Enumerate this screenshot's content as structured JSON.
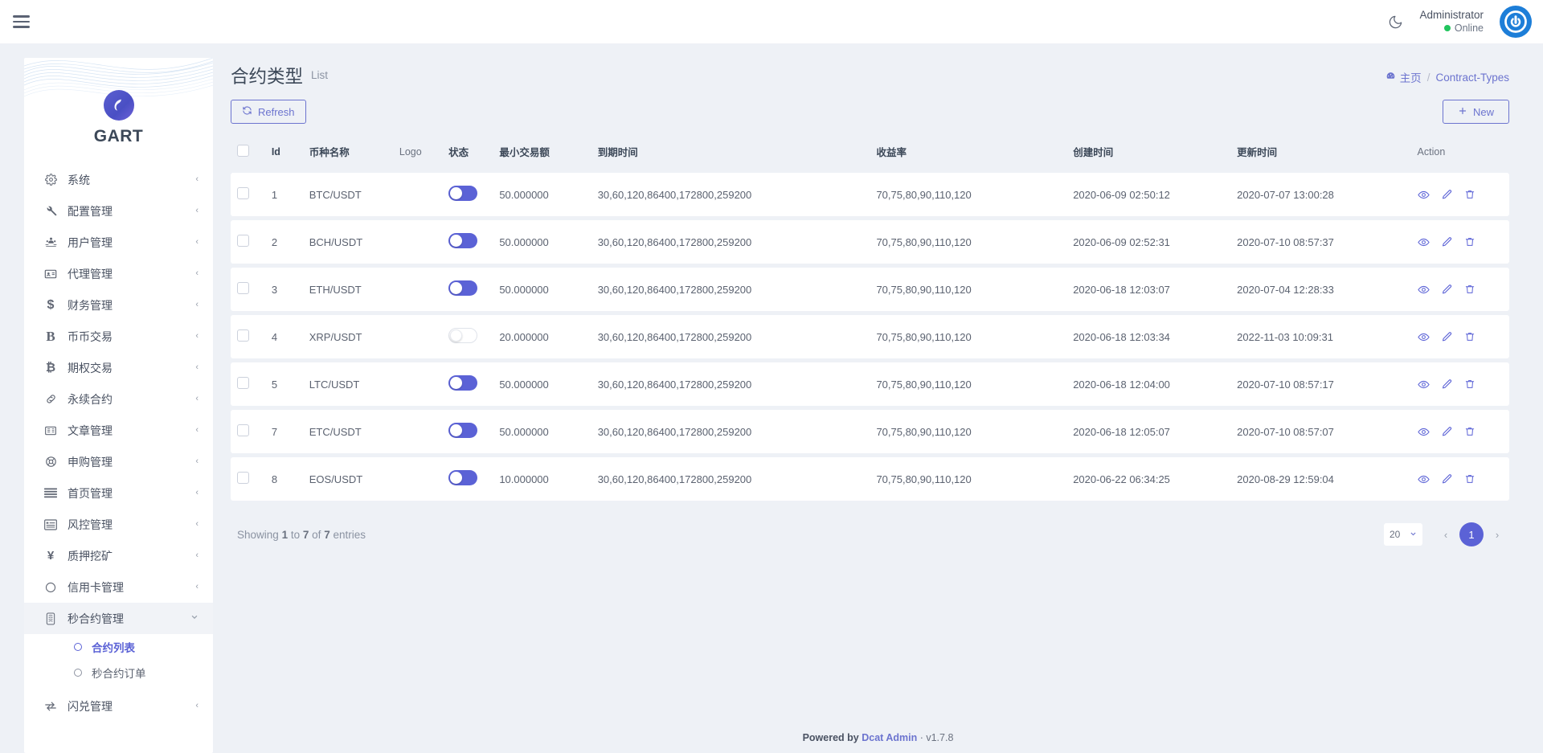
{
  "topbar": {
    "menu_icon": "hamburger-icon",
    "theme_icon": "moon-icon",
    "user_name": "Administrator",
    "user_status": "Online",
    "avatar_icon": "user-avatar-icon"
  },
  "sidebar": {
    "brand": "GART",
    "items": [
      {
        "label": "系统",
        "icon": "gear-icon",
        "caret": "‹"
      },
      {
        "label": "配置管理",
        "icon": "wrench-icon",
        "caret": "‹"
      },
      {
        "label": "用户管理",
        "icon": "users-icon",
        "caret": "‹"
      },
      {
        "label": "代理管理",
        "icon": "id-card-icon",
        "caret": "‹"
      },
      {
        "label": "财务管理",
        "icon": "dollar-icon",
        "caret": "‹"
      },
      {
        "label": "币币交易",
        "icon": "bold-b-icon",
        "caret": "‹"
      },
      {
        "label": "期权交易",
        "icon": "bitcoin-icon",
        "caret": "‹"
      },
      {
        "label": "永续合约",
        "icon": "link-icon",
        "caret": "‹"
      },
      {
        "label": "文章管理",
        "icon": "book-icon",
        "caret": "‹"
      },
      {
        "label": "申购管理",
        "icon": "lifebuoy-icon",
        "caret": "‹"
      },
      {
        "label": "首页管理",
        "icon": "bars-icon",
        "caret": "‹"
      },
      {
        "label": "风控管理",
        "icon": "list-alt-icon",
        "caret": "‹"
      },
      {
        "label": "质押挖矿",
        "icon": "yen-icon",
        "caret": "‹"
      },
      {
        "label": "信用卡管理",
        "icon": "circle-icon",
        "caret": "‹"
      }
    ],
    "expanded_group": {
      "label": "秒合约管理",
      "icon": "stamp-icon",
      "caret": "⌄"
    },
    "subitems": [
      {
        "label": "合约列表",
        "selected": true
      },
      {
        "label": "秒合约订单",
        "selected": false
      }
    ],
    "last_item": {
      "label": "闪兑管理",
      "icon": "exchange-icon",
      "caret": "‹"
    }
  },
  "page": {
    "title": "合约类型",
    "subtitle": "List",
    "breadcrumb_home": "主页",
    "breadcrumb_sep": "/",
    "breadcrumb_current": "Contract-Types",
    "refresh_label": "Refresh",
    "refresh_icon": "refresh-icon",
    "new_label": "New",
    "new_icon": "plus-icon"
  },
  "table": {
    "columns": [
      "",
      "Id",
      "币种名称",
      "Logo",
      "状态",
      "最小交易额",
      "到期时间",
      "收益率",
      "创建时间",
      "更新时间",
      "Action"
    ],
    "rows": [
      {
        "id": "1",
        "name": "BTC/USDT",
        "logo": "",
        "status": true,
        "min": "50.000000",
        "expiry": "30,60,120,86400,172800,259200",
        "rate": "70,75,80,90,110,120",
        "created": "2020-06-09 02:50:12",
        "updated": "2020-07-07 13:00:28"
      },
      {
        "id": "2",
        "name": "BCH/USDT",
        "logo": "",
        "status": true,
        "min": "50.000000",
        "expiry": "30,60,120,86400,172800,259200",
        "rate": "70,75,80,90,110,120",
        "created": "2020-06-09 02:52:31",
        "updated": "2020-07-10 08:57:37"
      },
      {
        "id": "3",
        "name": "ETH/USDT",
        "logo": "",
        "status": true,
        "min": "50.000000",
        "expiry": "30,60,120,86400,172800,259200",
        "rate": "70,75,80,90,110,120",
        "created": "2020-06-18 12:03:07",
        "updated": "2020-07-04 12:28:33"
      },
      {
        "id": "4",
        "name": "XRP/USDT",
        "logo": "",
        "status": false,
        "min": "20.000000",
        "expiry": "30,60,120,86400,172800,259200",
        "rate": "70,75,80,90,110,120",
        "created": "2020-06-18 12:03:34",
        "updated": "2022-11-03 10:09:31"
      },
      {
        "id": "5",
        "name": "LTC/USDT",
        "logo": "",
        "status": true,
        "min": "50.000000",
        "expiry": "30,60,120,86400,172800,259200",
        "rate": "70,75,80,90,110,120",
        "created": "2020-06-18 12:04:00",
        "updated": "2020-07-10 08:57:17"
      },
      {
        "id": "7",
        "name": "ETC/USDT",
        "logo": "",
        "status": true,
        "min": "50.000000",
        "expiry": "30,60,120,86400,172800,259200",
        "rate": "70,75,80,90,110,120",
        "created": "2020-06-18 12:05:07",
        "updated": "2020-07-10 08:57:07"
      },
      {
        "id": "8",
        "name": "EOS/USDT",
        "logo": "",
        "status": true,
        "min": "10.000000",
        "expiry": "30,60,120,86400,172800,259200",
        "rate": "70,75,80,90,110,120",
        "created": "2020-06-22 06:34:25",
        "updated": "2020-08-29 12:59:04"
      }
    ],
    "row_action_icons": [
      "eye-icon",
      "pencil-icon",
      "trash-icon"
    ]
  },
  "footer": {
    "showing_prefix": "Showing",
    "showing_from": "1",
    "showing_to_word": "to",
    "showing_to": "7",
    "showing_of_word": "of",
    "showing_total": "7",
    "showing_suffix": "entries",
    "per_page": "20",
    "prev": "‹",
    "current_page": "1",
    "next": "›"
  },
  "credit": {
    "powered": "Powered by",
    "product": "Dcat Admin",
    "dot": "·",
    "version": "v1.7.8"
  },
  "colors": {
    "accent": "#5b62d6",
    "link": "#6c74cf",
    "bg": "#eef1f6",
    "online": "#22c55e",
    "avatar": "#1d7ed8"
  }
}
